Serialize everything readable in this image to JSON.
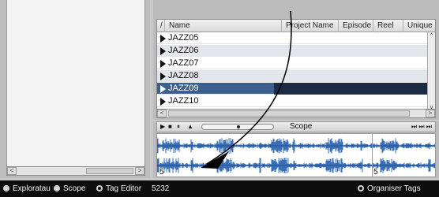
{
  "table": {
    "columns": [
      "Name",
      "Project Name",
      "Episode",
      "Reel",
      "Unique ID"
    ],
    "sort_indicator": "/",
    "rows": [
      "JAZZ05",
      "JAZZ06",
      "JAZZ07",
      "JAZZ08",
      "JAZZ09",
      "JAZZ10"
    ],
    "selected_row": "JAZZ09"
  },
  "scope": {
    "title": "Scope",
    "marker_label": "5",
    "start_label": "5",
    "transport": {
      "play": "▶",
      "stop": "■",
      "pause": "⏸",
      "loop": "▲",
      "right_controls": "⏭ ⏭ ⏭"
    }
  },
  "status_bar": {
    "explorer": "Exploratau",
    "scope": "Scope",
    "tag_editor": "Tag Editor",
    "count": "5232",
    "organiser": "Organiser Tags"
  },
  "scroll": {
    "left": "<",
    "right": ">",
    "up": "^",
    "down": "v"
  },
  "icons": {
    "row_arrow": "triangle-right-icon",
    "radio": "radio-button-icon"
  },
  "colors": {
    "selection": "#3d5f8e",
    "waveform": "#3b6fb5",
    "status_bg": "#0d0d0d"
  }
}
